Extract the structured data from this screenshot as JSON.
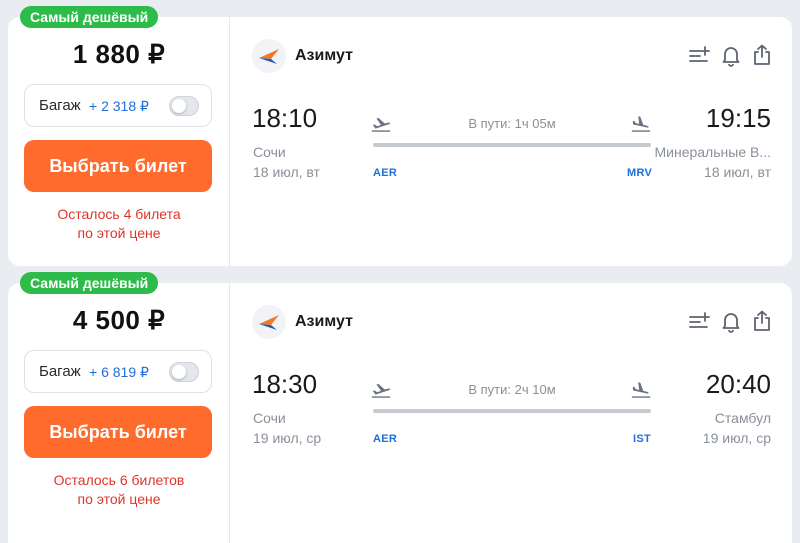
{
  "colors": {
    "accent_orange": "#ff6b2c",
    "badge_green": "#2dbb4a",
    "link_blue": "#1e6fd9",
    "warning_red": "#e0342b"
  },
  "offers": [
    {
      "badge": "Самый дешёвый",
      "price": "1 880 ₽",
      "baggage": {
        "label": "Багаж",
        "price": "+ 2 318 ₽",
        "enabled": false
      },
      "buy_label": "Выбрать билет",
      "note_line1": "Осталось 4 билета",
      "note_line2": "по этой цене",
      "airline": "Азимут",
      "depart": {
        "time": "18:10",
        "city": "Сочи",
        "date": "18 июл, вт",
        "iata": "AER"
      },
      "arrive": {
        "time": "19:15",
        "city": "Минеральные В...",
        "date": "18 июл, вт",
        "iata": "MRV"
      },
      "duration": "В пути: 1ч 05м",
      "icons": [
        "plane-takeoff-icon",
        "plane-landing-icon",
        "add-to-list-icon",
        "bell-icon",
        "share-icon"
      ]
    },
    {
      "badge": "Самый дешёвый",
      "price": "4 500 ₽",
      "baggage": {
        "label": "Багаж",
        "price": "+ 6 819 ₽",
        "enabled": false
      },
      "buy_label": "Выбрать билет",
      "note_line1": "Осталось 6 билетов",
      "note_line2": "по этой цене",
      "airline": "Азимут",
      "depart": {
        "time": "18:30",
        "city": "Сочи",
        "date": "19 июл, ср",
        "iata": "AER"
      },
      "arrive": {
        "time": "20:40",
        "city": "Стамбул",
        "date": "19 июл, ср",
        "iata": "IST"
      },
      "duration": "В пути: 2ч 10м",
      "icons": [
        "plane-takeoff-icon",
        "plane-landing-icon",
        "add-to-list-icon",
        "bell-icon",
        "share-icon"
      ]
    }
  ]
}
